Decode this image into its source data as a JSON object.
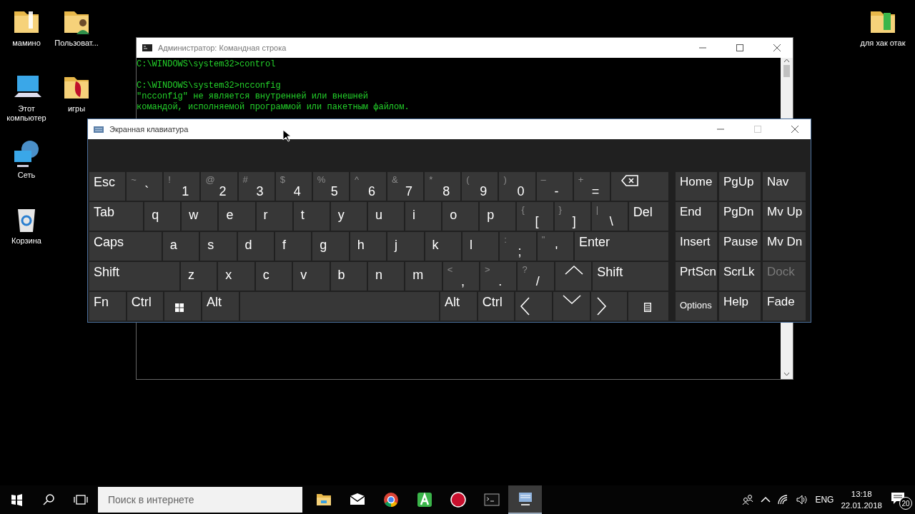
{
  "desktop_icons": [
    {
      "label": "мамино",
      "kind": "folder"
    },
    {
      "label": "Пользоват...",
      "kind": "user-folder"
    },
    {
      "label": "Этот компьютер",
      "kind": "computer"
    },
    {
      "label": "игры",
      "kind": "game-folder"
    },
    {
      "label": "Сеть",
      "kind": "network"
    },
    {
      "label": "Корзина",
      "kind": "bin"
    },
    {
      "label": "для хак отак",
      "kind": "app-folder"
    }
  ],
  "console_window": {
    "title": "Администратор: Командная строка",
    "blocks": [
      [
        "C:\\WINDOWS\\system32>control"
      ],
      [
        "C:\\WINDOWS\\system32>ncconfig",
        "\"ncconfig\" не является внутренней или внешней",
        "командой, исполняемой программой или пакетным файлом."
      ]
    ]
  },
  "keyboard_window": {
    "title": "Экранная клавиатура",
    "maximize_disabled": true,
    "rows": [
      [
        {
          "kind": "text",
          "label": "Esc"
        },
        {
          "kind": "text",
          "label": "`",
          "shift": "~"
        },
        {
          "kind": "text",
          "label": "1",
          "shift": "!"
        },
        {
          "kind": "text",
          "label": "2",
          "shift": "@"
        },
        {
          "kind": "text",
          "label": "3",
          "shift": "#"
        },
        {
          "kind": "text",
          "label": "4",
          "shift": "$"
        },
        {
          "kind": "text",
          "label": "5",
          "shift": "%"
        },
        {
          "kind": "text",
          "label": "6",
          "shift": "^"
        },
        {
          "kind": "text",
          "label": "7",
          "shift": "&"
        },
        {
          "kind": "text",
          "label": "8",
          "shift": "*"
        },
        {
          "kind": "text",
          "label": "9",
          "shift": "("
        },
        {
          "kind": "text",
          "label": "0",
          "shift": ")"
        },
        {
          "kind": "text",
          "label": "-",
          "shift": "–"
        },
        {
          "kind": "text",
          "label": "=",
          "shift": "+"
        },
        {
          "kind": "backspace"
        }
      ],
      [
        {
          "kind": "text",
          "label": "Tab"
        },
        {
          "kind": "text",
          "label": "q"
        },
        {
          "kind": "text",
          "label": "w"
        },
        {
          "kind": "text",
          "label": "e"
        },
        {
          "kind": "text",
          "label": "r"
        },
        {
          "kind": "text",
          "label": "t"
        },
        {
          "kind": "text",
          "label": "y"
        },
        {
          "kind": "text",
          "label": "u"
        },
        {
          "kind": "text",
          "label": "i"
        },
        {
          "kind": "text",
          "label": "o"
        },
        {
          "kind": "text",
          "label": "p"
        },
        {
          "kind": "text",
          "label": "[",
          "shift": "{"
        },
        {
          "kind": "text",
          "label": "]",
          "shift": "}"
        },
        {
          "kind": "text",
          "label": "\\",
          "shift": "|"
        },
        {
          "kind": "text",
          "label": "Del"
        }
      ],
      [
        {
          "kind": "text",
          "label": "Caps"
        },
        {
          "kind": "text",
          "label": "a"
        },
        {
          "kind": "text",
          "label": "s"
        },
        {
          "kind": "text",
          "label": "d"
        },
        {
          "kind": "text",
          "label": "f"
        },
        {
          "kind": "text",
          "label": "g"
        },
        {
          "kind": "text",
          "label": "h"
        },
        {
          "kind": "text",
          "label": "j"
        },
        {
          "kind": "text",
          "label": "k"
        },
        {
          "kind": "text",
          "label": "l"
        },
        {
          "kind": "text",
          "label": ";",
          "shift": ":"
        },
        {
          "kind": "text",
          "label": "'",
          "shift": "\""
        },
        {
          "kind": "text",
          "label": "Enter"
        }
      ],
      [
        {
          "kind": "text",
          "label": "Shift"
        },
        {
          "kind": "text",
          "label": "z"
        },
        {
          "kind": "text",
          "label": "x"
        },
        {
          "kind": "text",
          "label": "c"
        },
        {
          "kind": "text",
          "label": "v"
        },
        {
          "kind": "text",
          "label": "b"
        },
        {
          "kind": "text",
          "label": "n"
        },
        {
          "kind": "text",
          "label": "m"
        },
        {
          "kind": "text",
          "label": ",",
          "shift": "<"
        },
        {
          "kind": "text",
          "label": ".",
          "shift": ">"
        },
        {
          "kind": "text",
          "label": "/",
          "shift": "?"
        },
        {
          "kind": "up"
        },
        {
          "kind": "text",
          "label": "Shift"
        }
      ],
      [
        {
          "kind": "text",
          "label": "Fn"
        },
        {
          "kind": "text",
          "label": "Ctrl"
        },
        {
          "kind": "windows"
        },
        {
          "kind": "text",
          "label": "Alt"
        },
        {
          "kind": "space"
        },
        {
          "kind": "text",
          "label": "Alt"
        },
        {
          "kind": "text",
          "label": "Ctrl"
        },
        {
          "kind": "left"
        },
        {
          "kind": "down"
        },
        {
          "kind": "right"
        },
        {
          "kind": "menu"
        }
      ]
    ],
    "nav_keys": [
      {
        "label": "Home",
        "disabled": false
      },
      {
        "label": "PgUp",
        "disabled": false
      },
      {
        "label": "Nav",
        "disabled": false
      },
      {
        "label": "End",
        "disabled": false
      },
      {
        "label": "PgDn",
        "disabled": false
      },
      {
        "label": "Mv Up",
        "disabled": false
      },
      {
        "label": "Insert",
        "disabled": false
      },
      {
        "label": "Pause",
        "disabled": false
      },
      {
        "label": "Mv Dn",
        "disabled": false
      },
      {
        "label": "PrtScn",
        "disabled": false
      },
      {
        "label": "ScrLk",
        "disabled": false
      },
      {
        "label": "Dock",
        "disabled": true
      },
      {
        "label": "Options",
        "disabled": false
      },
      {
        "label": "Help",
        "disabled": false
      },
      {
        "label": "Fade",
        "disabled": false
      }
    ]
  },
  "taskbar": {
    "search": {
      "placeholder": "Поиск в интернете"
    },
    "apps": [
      {
        "kind": "explorer",
        "selected": false
      },
      {
        "kind": "mail",
        "selected": false
      },
      {
        "kind": "browser",
        "selected": false
      },
      {
        "kind": "green-a",
        "selected": false
      },
      {
        "kind": "record",
        "selected": false
      },
      {
        "kind": "console",
        "selected": false
      },
      {
        "kind": "keyboard",
        "selected": true
      }
    ],
    "language": "ENG",
    "time": "13:18",
    "date": "22.01.2018",
    "notifications": "20"
  }
}
